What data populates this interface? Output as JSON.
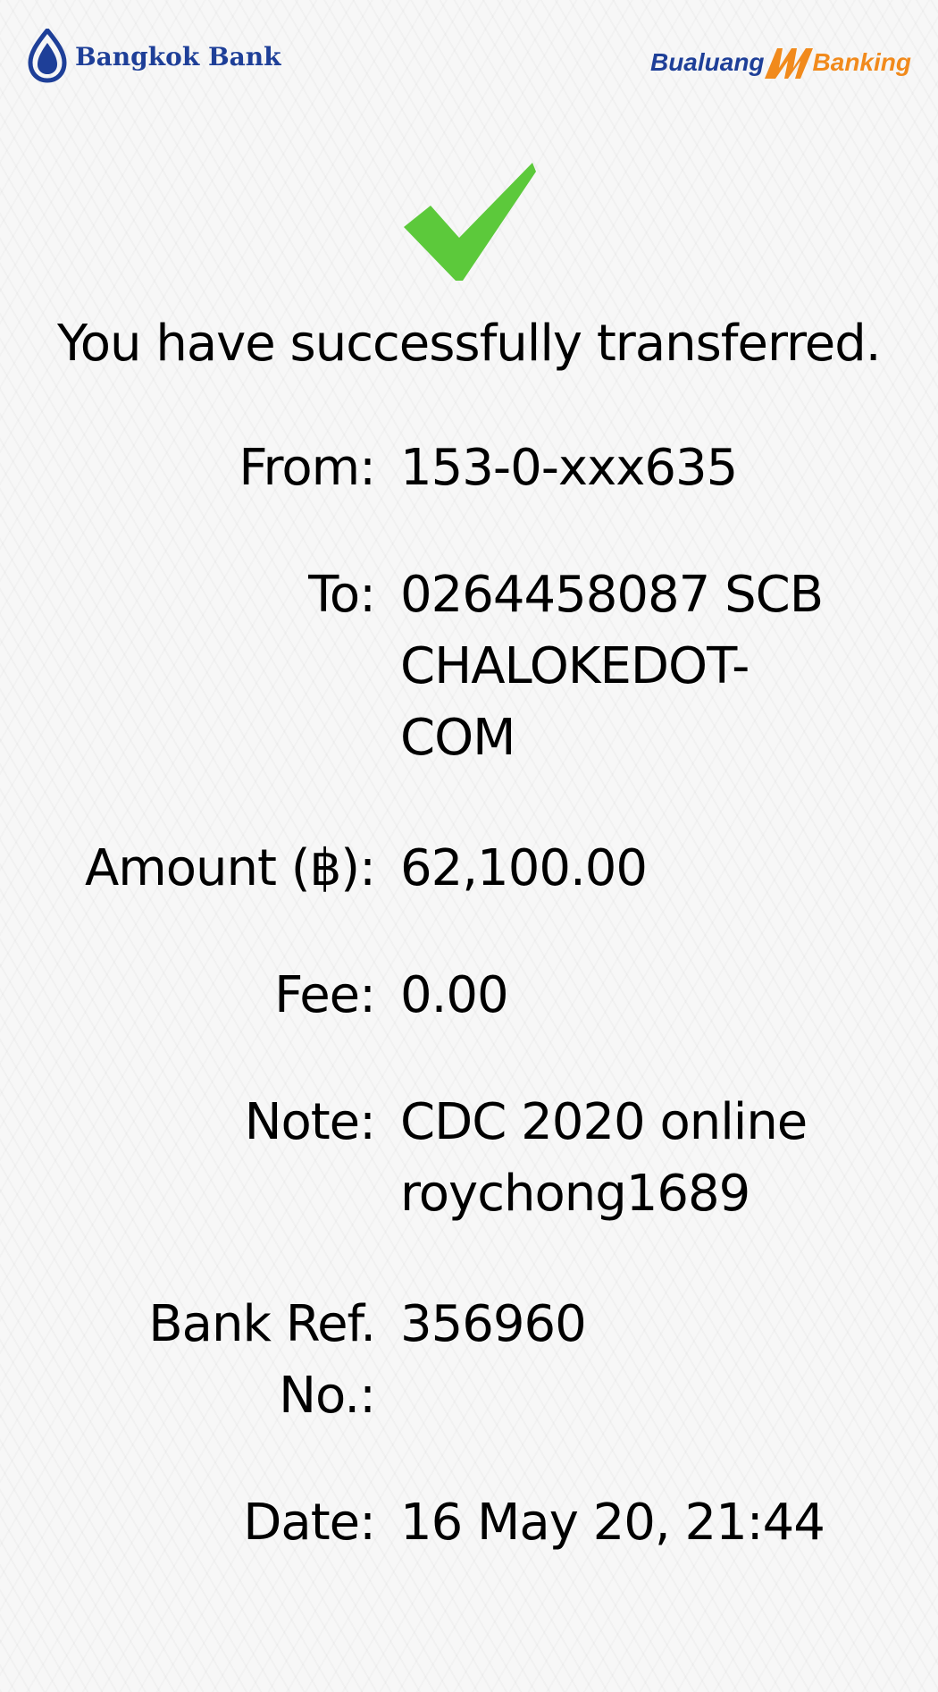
{
  "header": {
    "bank_logo_text": "Bangkok Bank",
    "app_logo": {
      "part1": "Bualuang",
      "part2": "Banking"
    }
  },
  "status_icon": "checkmark-icon",
  "headline": "You have successfully transferred.",
  "details": {
    "from": {
      "label": "From:",
      "value": "153-0-xxx635"
    },
    "to": {
      "label": "To:",
      "value_lines": [
        "0264458087 SCB",
        "CHALOKEDOT-",
        "COM"
      ]
    },
    "amount": {
      "label": "Amount (฿):",
      "value": "62,100.00"
    },
    "fee": {
      "label": "Fee:",
      "value": "0.00"
    },
    "note": {
      "label": "Note:",
      "value_lines": [
        "CDC 2020 online",
        "roychong1689"
      ]
    },
    "bank_ref": {
      "label_lines": [
        "Bank Ref.",
        "No.:"
      ],
      "value": "356960"
    },
    "date": {
      "label": "Date:",
      "value": "16 May 20, 21:44"
    }
  },
  "colors": {
    "brand_blue": "#1e3f98",
    "brand_orange": "#f18a1c",
    "success_green": "#5cc93b",
    "background": "#f7f7f7"
  }
}
